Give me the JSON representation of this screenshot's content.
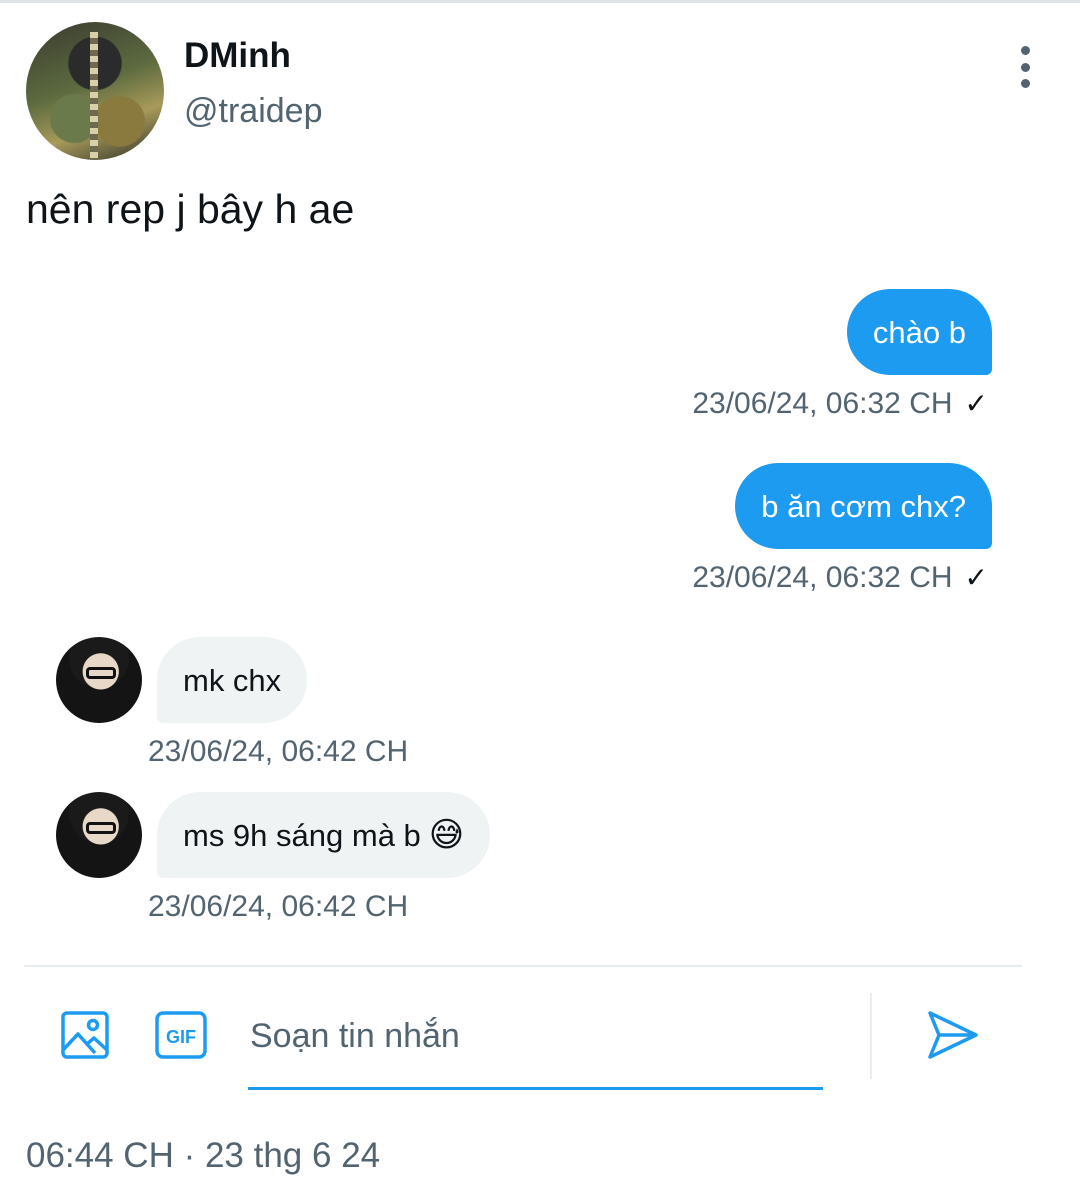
{
  "header": {
    "display_name": "DMinh",
    "handle": "@traidep",
    "more_icon": "more-vertical-icon"
  },
  "tweet": {
    "text": "nên rep j bây h ae"
  },
  "messages": [
    {
      "direction": "outgoing",
      "text": "chào b",
      "timestamp": "23/06/24, 06:32 CH",
      "status": "✓"
    },
    {
      "direction": "outgoing",
      "text": "b ăn cơm chx?",
      "timestamp": "23/06/24, 06:32 CH",
      "status": "✓"
    },
    {
      "direction": "incoming",
      "text": "mk chx",
      "timestamp": "23/06/24, 06:42 CH"
    },
    {
      "direction": "incoming",
      "text": "ms 9h sáng mà b",
      "emoji": "😅",
      "timestamp": "23/06/24, 06:42 CH"
    }
  ],
  "composer": {
    "placeholder": "Soạn tin nhắn",
    "image_icon": "image-icon",
    "gif_label": "GIF",
    "send_icon": "send-icon"
  },
  "footer": {
    "time": "06:44 CH · 23 thg 6 24"
  },
  "colors": {
    "accent": "#1d9bf0",
    "incoming_bubble": "#eff3f4",
    "secondary_text": "#536471"
  }
}
